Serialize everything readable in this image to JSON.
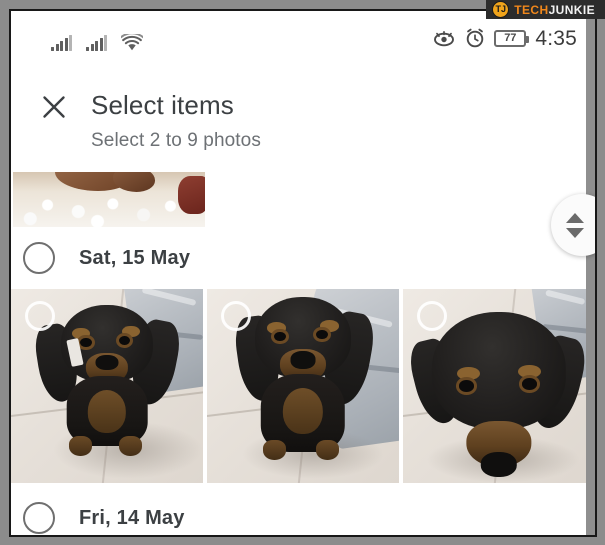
{
  "watermark": {
    "logo_text": "TJ",
    "brand_part1": "TECH",
    "brand_part2": "JUNKIE",
    "accent_color": "#f0871b",
    "bg_color": "#2c2c2c"
  },
  "status_bar": {
    "signal_1": "signal-bars-icon",
    "signal_2": "signal-bars-icon",
    "wifi": "wifi-icon",
    "eye": "eye-icon",
    "alarm": "alarm-clock-icon",
    "battery_level": "77",
    "time": "4:35"
  },
  "header": {
    "close_icon": "close-icon",
    "title": "Select items",
    "subtitle": "Select 2 to 9 photos"
  },
  "content": {
    "partial_row": {
      "name": "food-photo-partial",
      "description": "rice-and-meat-photo"
    },
    "sections": [
      {
        "date_label": "Sat, 15 May",
        "checkbox_state": "unchecked",
        "photos": [
          {
            "description": "puppy-sitting-on-tile-floor",
            "selected": false
          },
          {
            "description": "puppy-sitting-closeup",
            "selected": false
          },
          {
            "description": "puppy-head-from-above",
            "selected": false
          }
        ]
      },
      {
        "date_label": "Fri, 14 May",
        "checkbox_state": "unchecked",
        "photos": []
      }
    ]
  },
  "scrollbar": {
    "track_color": "#8f8f8f",
    "handle_up_icon": "triangle-up-icon",
    "handle_down_icon": "triangle-down-icon"
  }
}
